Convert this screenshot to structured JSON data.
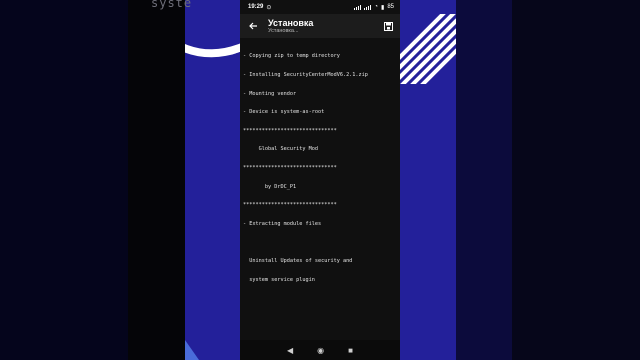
{
  "background": {
    "overlay_text": "syste"
  },
  "status_bar": {
    "time": "19:29",
    "battery": "85"
  },
  "app_bar": {
    "title": "Установка",
    "subtitle": "Установка..."
  },
  "console": {
    "lines": [
      "- Copying zip to temp directory",
      "- Installing SecurityCenterModV6.2.1.zip",
      "- Mounting vendor",
      "- Device is system-as-root",
      "******************************",
      "     Global Security Mod",
      "******************************",
      "       by DrDC_P1",
      "******************************",
      "- Extracting module files",
      "",
      "  Uninstall Updates of security and",
      "  system service plugin"
    ]
  },
  "navbar": {
    "back_glyph": "◀",
    "home_glyph": "◉",
    "recents_glyph": "■"
  },
  "colors": {
    "accent_blue": "#23209a",
    "phone_bg": "#101010"
  }
}
